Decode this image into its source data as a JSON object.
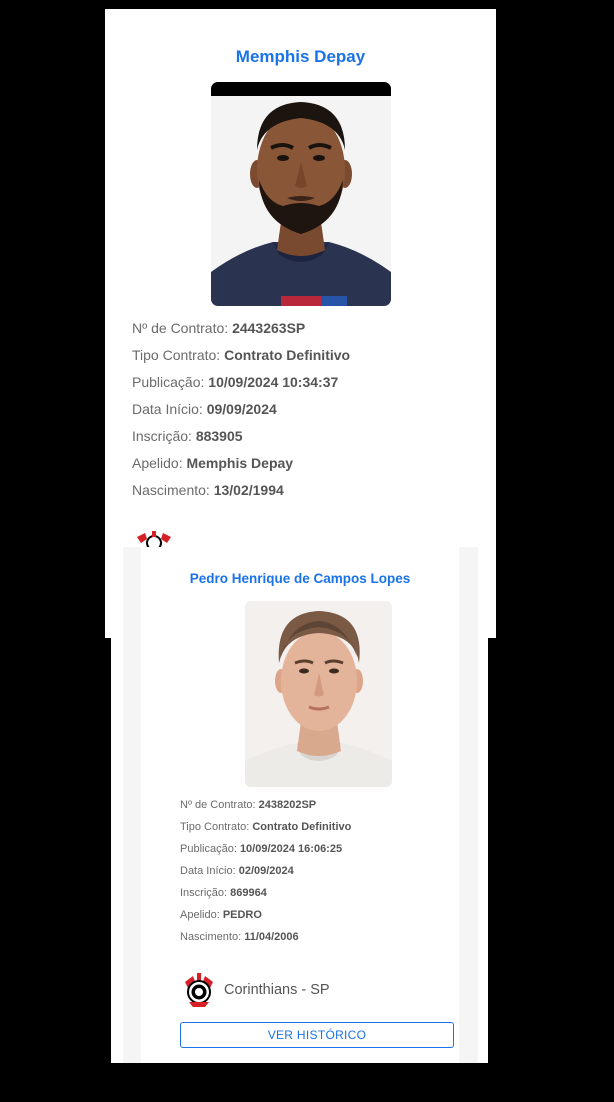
{
  "colors": {
    "accent": "#1a73e8",
    "club_red": "#d61f26",
    "background": "#000000"
  },
  "player1": {
    "name": "Memphis Depay",
    "fields": [
      {
        "label": "Nº de Contrato: ",
        "value": "2443263SP"
      },
      {
        "label": "Tipo Contrato: ",
        "value": "Contrato Definitivo"
      },
      {
        "label": "Publicação: ",
        "value": "10/09/2024 10:34:37"
      },
      {
        "label": "Data Início: ",
        "value": "09/09/2024"
      },
      {
        "label": "Inscrição: ",
        "value": "883905"
      },
      {
        "label": "Apelido: ",
        "value": "Memphis Depay"
      },
      {
        "label": "Nascimento: ",
        "value": "13/02/1994"
      }
    ],
    "club_icon": "corinthians-crest-icon"
  },
  "player2": {
    "name": "Pedro Henrique de Campos Lopes",
    "fields": [
      {
        "label": "Nº de Contrato: ",
        "value": "2438202SP"
      },
      {
        "label": "Tipo Contrato: ",
        "value": "Contrato Definitivo"
      },
      {
        "label": "Publicação: ",
        "value": "10/09/2024 16:06:25"
      },
      {
        "label": "Data Início: ",
        "value": "02/09/2024"
      },
      {
        "label": "Inscrição: ",
        "value": "869964"
      },
      {
        "label": "Apelido: ",
        "value": "PEDRO"
      },
      {
        "label": "Nascimento: ",
        "value": "11/04/2006"
      }
    ],
    "club": "Corinthians - SP",
    "club_icon": "corinthians-crest-icon",
    "button_label": "VER HISTÓRICO"
  }
}
